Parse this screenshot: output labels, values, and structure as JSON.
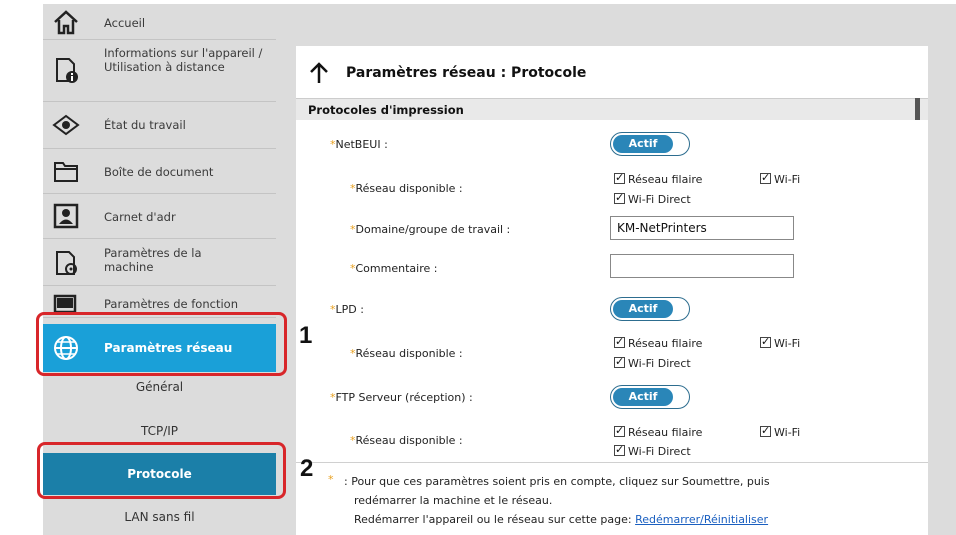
{
  "sidebar": {
    "items": [
      {
        "label": "Accueil",
        "icon": "home-icon"
      },
      {
        "label": "Informations sur l'appareil / Utilisation à distance",
        "icon": "device-info-icon"
      },
      {
        "label": "État du travail",
        "icon": "eye-icon"
      },
      {
        "label": "Boîte de document",
        "icon": "folder-icon"
      },
      {
        "label": "Carnet d'adr",
        "icon": "address-book-icon"
      },
      {
        "label": "Paramètres de la machine",
        "icon": "machine-settings-icon"
      },
      {
        "label": "Paramètres de fonction",
        "icon": "function-settings-icon"
      },
      {
        "label": "Paramètres réseau",
        "icon": "globe-icon"
      }
    ],
    "sub_items": [
      "Général",
      "TCP/IP",
      "Protocole",
      "LAN sans fil"
    ]
  },
  "page": {
    "title": "Paramètres réseau : Protocole",
    "section": "Protocoles d'impression"
  },
  "fields": {
    "netbeui_label": "NetBEUI :",
    "netbeui_toggle": "Actif",
    "netbeui_network_label": "Réseau disponible :",
    "domain_label": "Domaine/groupe de travail :",
    "domain_value": "KM-NetPrinters",
    "comment_label": "Commentaire :",
    "comment_value": "",
    "lpd_label": "LPD :",
    "lpd_toggle": "Actif",
    "lpd_network_label": "Réseau disponible :",
    "ftp_label": "FTP Serveur (réception) :",
    "ftp_toggle": "Actif",
    "ftp_network_label": "Réseau disponible :",
    "required_mark": "*"
  },
  "checkboxes": {
    "wired": "Réseau filaire",
    "wifi": "Wi-Fi",
    "wifi_direct": "Wi-Fi Direct"
  },
  "footer": {
    "star": "*",
    "line1": ": Pour que ces paramètres soient pris en compte, cliquez sur Soumettre, puis",
    "line2": "redémarrer la machine et le réseau.",
    "line3": "Redémarrer l'appareil ou le réseau sur cette page:",
    "link": "Redémarrer/Réinitialiser"
  },
  "callouts": {
    "one": "1",
    "two": "2"
  },
  "colors": {
    "accent": "#1aa0d8",
    "selected": "#1b7fa8",
    "callout": "#d8262a",
    "toggle": "#2a86b8"
  }
}
